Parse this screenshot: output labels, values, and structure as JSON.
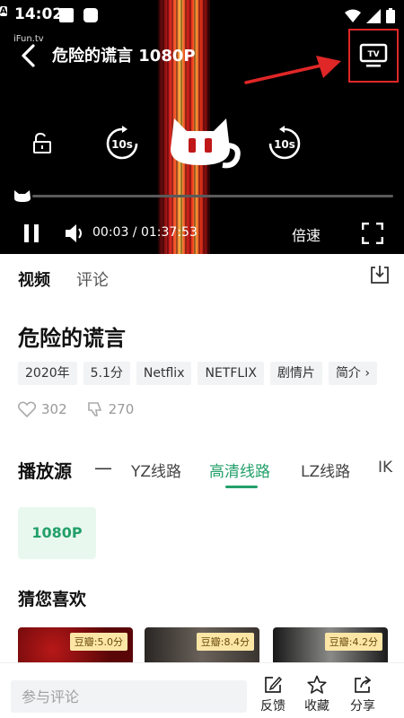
{
  "status_bar": {
    "time": "14:02",
    "icons": [
      "notification-square-icon",
      "notification-round-icon",
      "notification-a-icon",
      "wifi-icon",
      "signal-icon",
      "battery-icon"
    ]
  },
  "player": {
    "watermark": "iFun.tv",
    "title": "危险的谎言 1080P",
    "current_time": "00:03",
    "duration": "01:37:53",
    "time_separator": " / ",
    "speed_label": "倍速",
    "skip_back_label": "10s",
    "skip_forward_label": "10s",
    "tv_label": "TV",
    "progress": 0.0005
  },
  "tabs": [
    {
      "label": "视频",
      "active": true
    },
    {
      "label": "评论",
      "active": false
    }
  ],
  "movie": {
    "title": "危险的谎言",
    "tags": [
      "2020年",
      "5.1分",
      "Netflix",
      "NETFLIX",
      "剧情片",
      "简介"
    ],
    "likes": "302",
    "dislikes": "270"
  },
  "sources": {
    "label": "播放源",
    "separator": "—",
    "items": [
      {
        "label": "YZ线路"
      },
      {
        "label": "高清线路",
        "active": true
      },
      {
        "label": "LZ线路"
      },
      {
        "label": "IK"
      }
    ],
    "quality": "1080P"
  },
  "recommend": {
    "title": "猜您喜欢",
    "items": [
      {
        "rating": "豆瓣:5.0分"
      },
      {
        "rating": "豆瓣:8.4分"
      },
      {
        "rating": "豆瓣:4.2分"
      }
    ]
  },
  "bottom_bar": {
    "comment_placeholder": "参与评论",
    "feedback": "反馈",
    "favorite": "收藏",
    "share": "分享"
  },
  "colors": {
    "accent": "#23a06a",
    "highlight_box": "#e02626",
    "player_bg": "#000000"
  }
}
